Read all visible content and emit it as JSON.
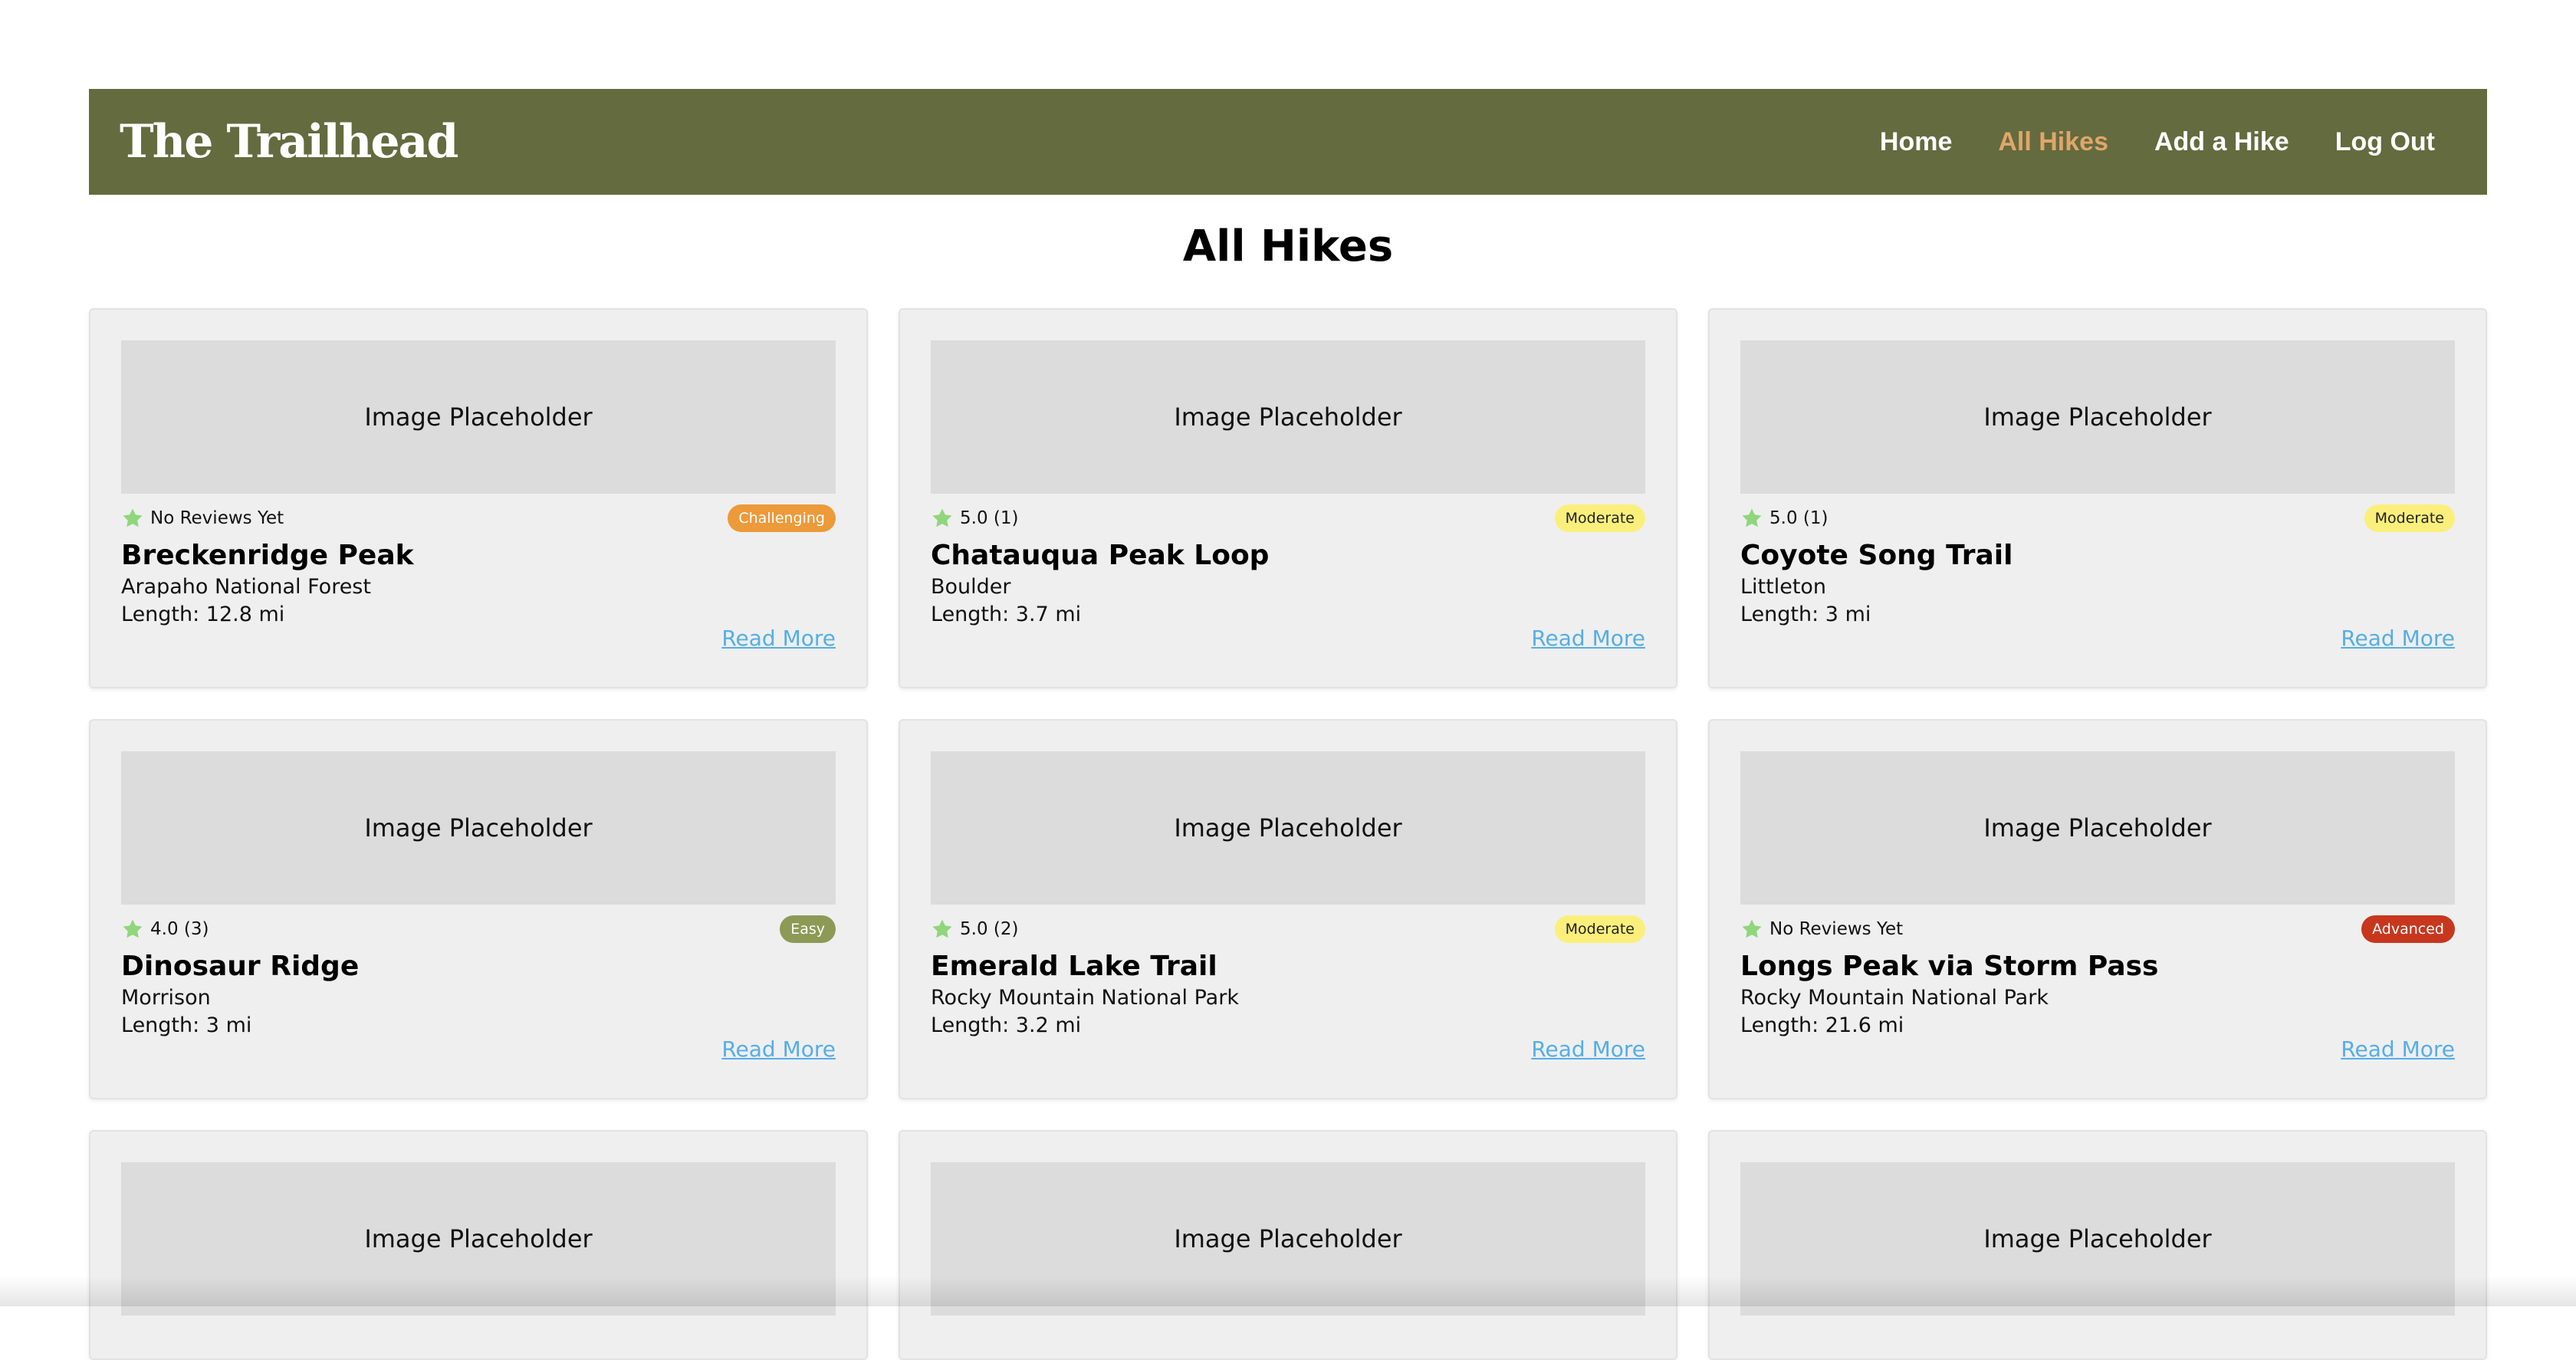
{
  "nav": {
    "brand": "The Trailhead",
    "links": [
      {
        "label": "Home",
        "active": false
      },
      {
        "label": "All Hikes",
        "active": true
      },
      {
        "label": "Add a Hike",
        "active": false
      },
      {
        "label": "Log Out",
        "active": false
      }
    ]
  },
  "page_title": "All Hikes",
  "image_placeholder_text": "Image Placeholder",
  "read_more_label": "Read More",
  "hikes": [
    {
      "name": "Breckenridge Peak",
      "location": "Arapaho National Forest",
      "length": "Length: 12.8 mi",
      "rating": "No Reviews Yet",
      "difficulty": "Challenging",
      "difficulty_color": "#ec9a3a"
    },
    {
      "name": "Chatauqua Peak Loop",
      "location": "Boulder",
      "length": "Length: 3.7 mi",
      "rating": "5.0 (1)",
      "difficulty": "Moderate",
      "difficulty_color": "#fbef7c"
    },
    {
      "name": "Coyote Song Trail",
      "location": "Littleton",
      "length": "Length: 3 mi",
      "rating": "5.0 (1)",
      "difficulty": "Moderate",
      "difficulty_color": "#fbef7c"
    },
    {
      "name": "Dinosaur Ridge",
      "location": "Morrison",
      "length": "Length: 3 mi",
      "rating": "4.0 (3)",
      "difficulty": "Easy",
      "difficulty_color": "#8c9a56"
    },
    {
      "name": "Emerald Lake Trail",
      "location": "Rocky Mountain National Park",
      "length": "Length: 3.2 mi",
      "rating": "5.0 (2)",
      "difficulty": "Moderate",
      "difficulty_color": "#fbef7c"
    },
    {
      "name": "Longs Peak via Storm Pass",
      "location": "Rocky Mountain National Park",
      "length": "Length: 21.6 mi",
      "rating": "No Reviews Yet",
      "difficulty": "Advanced",
      "difficulty_color": "#c7371e"
    }
  ],
  "colors": {
    "navbar_bg": "#646b3e",
    "nav_active": "#e0a66a",
    "link": "#55aee6",
    "star": "#8fd67c",
    "card_bg": "#efefef",
    "placeholder_bg": "#dcdcdc"
  },
  "icons": {
    "rating": "star-icon"
  }
}
